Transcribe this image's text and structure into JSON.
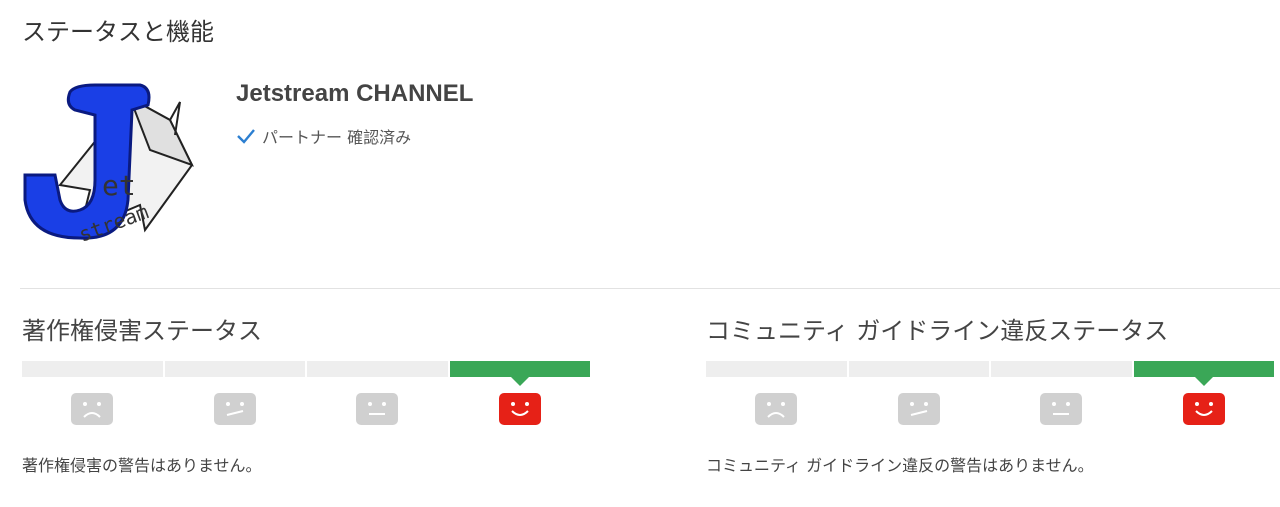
{
  "page": {
    "title": "ステータスと機能"
  },
  "channel": {
    "name": "Jetstream CHANNEL",
    "badge": "パートナー 確認済み",
    "logo": {
      "letter": "J",
      "text1": "et",
      "text2": "stream"
    }
  },
  "colors": {
    "active": "#3aa757",
    "inactive": "#eeeeee",
    "face_inactive": "#d0d0d0",
    "face_active": "#e62117",
    "check": "#2c7fd1"
  },
  "copyright": {
    "title": "著作権侵害ステータス",
    "level": 4,
    "levels": 4,
    "faces": [
      "frown-face-icon",
      "uneasy-face-icon",
      "neutral-face-icon",
      "smile-face-icon"
    ],
    "message": "著作権侵害の警告はありません。"
  },
  "community": {
    "title": "コミュニティ ガイドライン違反ステータス",
    "level": 4,
    "levels": 4,
    "faces": [
      "frown-face-icon",
      "uneasy-face-icon",
      "neutral-face-icon",
      "smile-face-icon"
    ],
    "message": "コミュニティ ガイドライン違反の警告はありません。"
  }
}
